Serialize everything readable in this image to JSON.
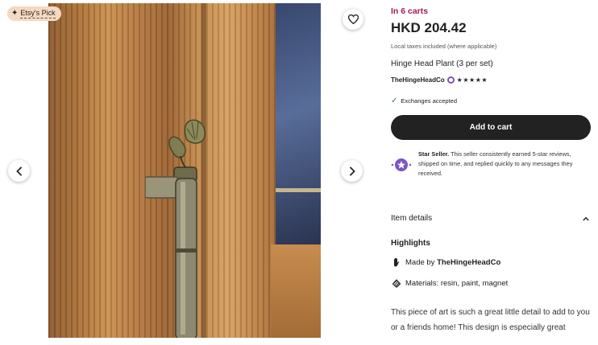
{
  "gallery": {
    "badge": {
      "label": "Etsy's Pick",
      "icon": "sparkle-icon"
    },
    "favorite_icon": "heart-icon",
    "prev_icon": "chevron-left-icon",
    "next_icon": "chevron-right-icon"
  },
  "listing": {
    "carts_text": "In 6 carts",
    "price": "HKD 204.42",
    "taxes_note": "Local taxes included (where applicable)",
    "title": "Hinge Head Plant (3 per set)",
    "shop_name": "TheHingeHeadCo",
    "rating_stars": "★★★★★",
    "rating": 5,
    "exchanges": "Exchanges accepted",
    "add_to_cart": "Add to cart",
    "star_seller_title": "Star Seller.",
    "star_seller_body": " This seller consistently earned 5-star reviews, shipped on time, and replied quickly to any messages they received.",
    "item_details_label": "Item details",
    "highlights_label": "Highlights",
    "made_by_prefix": "Made by ",
    "made_by_shop": "TheHingeHeadCo",
    "materials_prefix": "Materials: ",
    "materials": "resin, paint, magnet",
    "description": "This piece of art is such a great little detail to add to you or a friends home! This design is especially great"
  },
  "colors": {
    "accent_carts": "#a61a5c",
    "cart_button": "#222222",
    "star_seller_purple": "#7b55c7",
    "badge_bg": "#f6d9c0"
  }
}
